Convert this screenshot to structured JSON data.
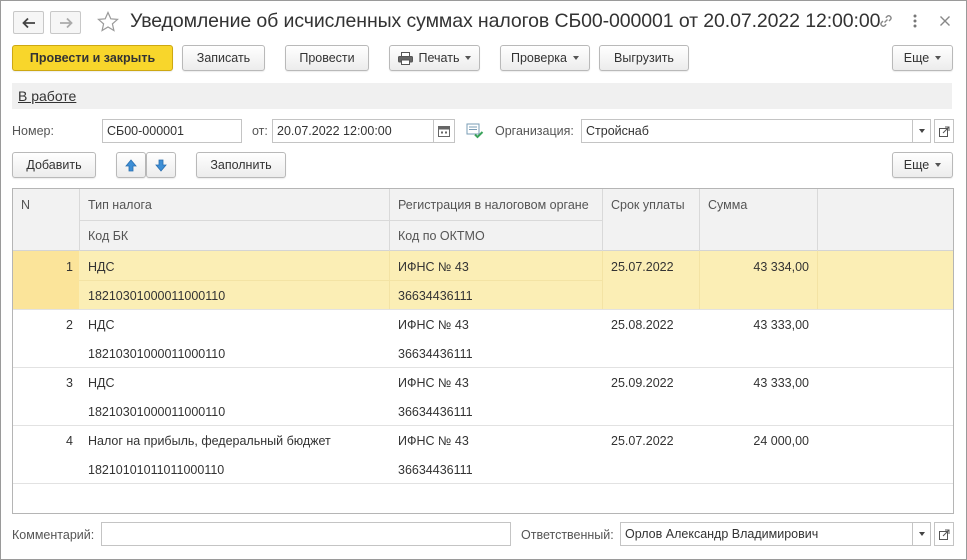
{
  "window": {
    "title": "Уведомление об исчисленных суммах налогов СБ00-000001 от 20.07.2022 12:00:00"
  },
  "toolbar": {
    "post_close": "Провести и закрыть",
    "save": "Записать",
    "post": "Провести",
    "print": "Печать",
    "check": "Проверка",
    "export": "Выгрузить",
    "more": "Еще"
  },
  "status": {
    "label": "В работе"
  },
  "header": {
    "number_label": "Номер:",
    "number_value": "СБ00-000001",
    "date_label": "от:",
    "date_value": "20.07.2022 12:00:00",
    "org_label": "Организация:",
    "org_value": "Стройснаб"
  },
  "table_toolbar": {
    "add": "Добавить",
    "fill": "Заполнить",
    "more": "Еще"
  },
  "table": {
    "columns": {
      "n": "N",
      "tax_type": "Тип налога",
      "kbk": "Код БК",
      "registration": "Регистрация в налоговом органе",
      "oktmo": "Код по ОКТМО",
      "due_date": "Срок уплаты",
      "amount": "Сумма"
    },
    "rows": [
      {
        "n": "1",
        "tax_type": "НДС",
        "kbk": "18210301000011000110",
        "registration": "ИФНС № 43",
        "oktmo": "36634436111",
        "due_date": "25.07.2022",
        "amount": "43 334,00"
      },
      {
        "n": "2",
        "tax_type": "НДС",
        "kbk": "18210301000011000110",
        "registration": "ИФНС № 43",
        "oktmo": "36634436111",
        "due_date": "25.08.2022",
        "amount": "43 333,00"
      },
      {
        "n": "3",
        "tax_type": "НДС",
        "kbk": "18210301000011000110",
        "registration": "ИФНС № 43",
        "oktmo": "36634436111",
        "due_date": "25.09.2022",
        "amount": "43 333,00"
      },
      {
        "n": "4",
        "tax_type": "Налог на прибыль, федеральный бюджет",
        "kbk": "18210101011011000110",
        "registration": "ИФНС № 43",
        "oktmo": "36634436111",
        "due_date": "25.07.2022",
        "amount": "24 000,00"
      }
    ]
  },
  "footer": {
    "comment_label": "Комментарий:",
    "comment_value": "",
    "responsible_label": "Ответственный:",
    "responsible_value": "Орлов Александр Владимирович"
  },
  "colors": {
    "primary_button": "#f8d62b",
    "selected_row": "#fbeeb5",
    "selected_cell": "#fbe49a",
    "arrow_blue": "#3d8fd6"
  }
}
